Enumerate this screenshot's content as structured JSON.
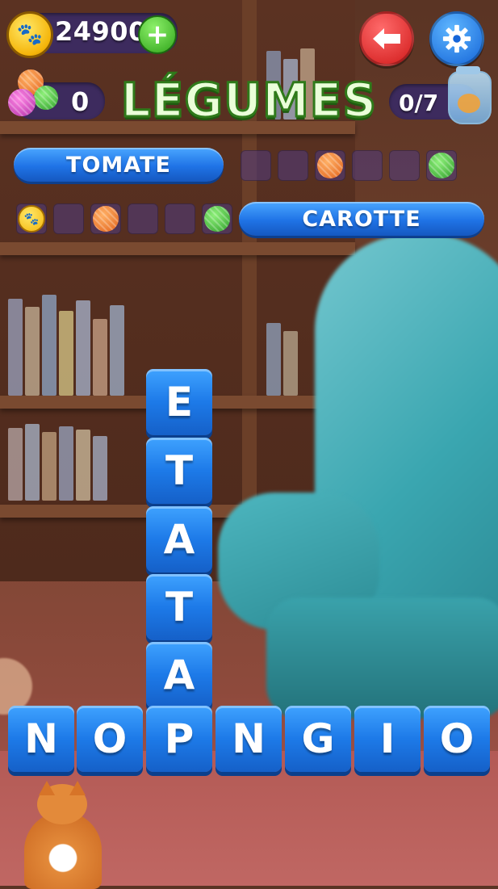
{
  "header": {
    "coins": "24900",
    "yarn_count": "0",
    "level_title": "LÉGUMES",
    "progress": "0/7"
  },
  "words": [
    {
      "label": "TOMATE",
      "slots": [
        "empty",
        "empty",
        "yarn-orange",
        "empty",
        "empty",
        "yarn-green"
      ]
    },
    {
      "label": "CAROTTE",
      "slots": [
        "coin",
        "empty",
        "yarn-orange",
        "empty",
        "empty",
        "yarn-green"
      ]
    }
  ],
  "column_tiles": [
    "E",
    "T",
    "A",
    "T",
    "A"
  ],
  "row_tiles": [
    "N",
    "O",
    "P",
    "N",
    "G",
    "I",
    "O"
  ],
  "icons": {
    "coin": "paw-coin-icon",
    "add": "plus-icon",
    "back": "arrow-left-icon",
    "settings": "gear-icon",
    "yarn": "yarn-balls-icon",
    "jar": "fish-jar-icon",
    "mascot": "orange-cat"
  },
  "colors": {
    "tile_blue": "#1d7ae8",
    "title_green": "#2f7a1a",
    "back_red": "#d11a1a",
    "settings_blue": "#1565d8"
  }
}
